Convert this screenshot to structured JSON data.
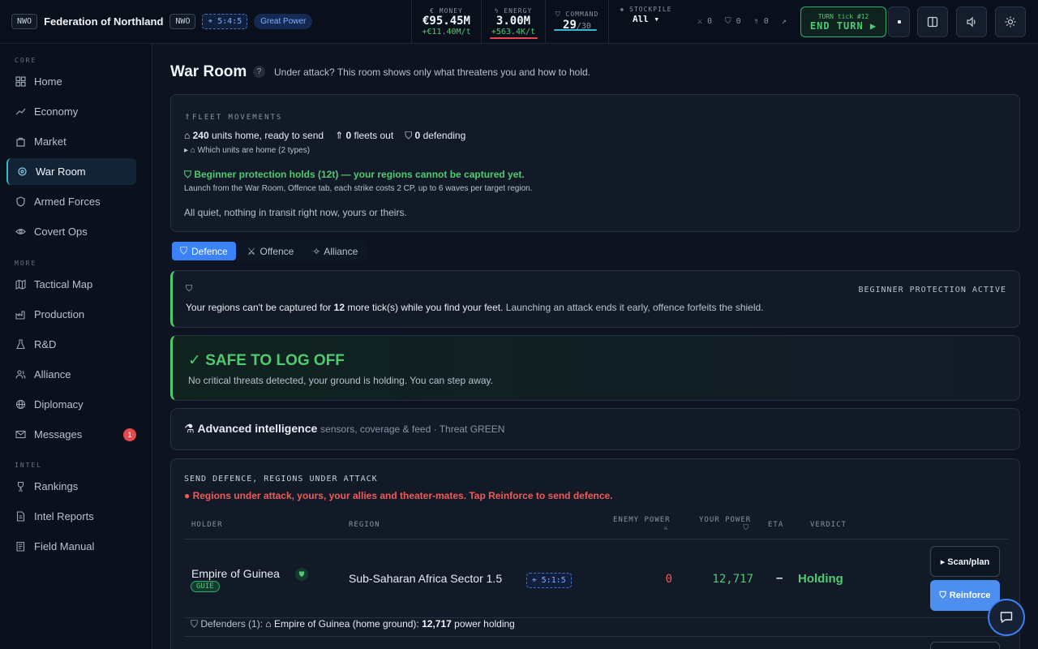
{
  "topbar": {
    "nation_code": "NWO",
    "nation_name": "Federation of Northland",
    "nation_code2": "NWO",
    "location": "5:4:5",
    "power_badge": "Great Power",
    "money_label": "€ MONEY",
    "money_value": "€95.45M",
    "money_rate": "+€11.40M/t",
    "energy_label": "ENERGY",
    "energy_value": "3.00M",
    "energy_rate": "+563.4K/t",
    "command_label": "COMMAND",
    "command_value": "29",
    "command_max": "/30",
    "stockpile_label": "STOCKPILE",
    "stockpile_value": "All ▾",
    "count_attack": "0",
    "count_defend": "0",
    "count_fleet": "0",
    "turn_label": "TURN tick #12",
    "end_turn_label": "END TURN ▶"
  },
  "sidebar": {
    "sections": [
      "CORE",
      "MORE",
      "INTEL"
    ],
    "core_items": [
      "Home",
      "Economy",
      "Market",
      "War Room",
      "Armed Forces",
      "Covert Ops"
    ],
    "more_items": [
      "Tactical Map",
      "Production",
      "R&D",
      "Alliance",
      "Diplomacy",
      "Messages"
    ],
    "intel_items": [
      "Rankings",
      "Intel Reports",
      "Field Manual"
    ],
    "messages_badge": "1"
  },
  "page": {
    "title": "War Room",
    "help": "?",
    "subtitle": "Under attack? This room shows only what threatens you and how to hold."
  },
  "fleet": {
    "label": "FLEET MOVEMENTS",
    "units_home_count": "240",
    "units_home_text": "units home, ready to send",
    "fleets_out_count": "0",
    "fleets_out_text": "fleets out",
    "defending_count": "0",
    "defending_text": "defending",
    "units_toggle": "Which units are home (2 types)",
    "protection_text": "Beginner protection holds (12t) — your regions cannot be captured yet.",
    "launch_text": "Launch from the War Room, Offence tab, each strike costs 2 CP, up to 6 waves per target region.",
    "quiet_text": "All quiet, nothing in transit right now, yours or theirs."
  },
  "tabs": [
    "Defence",
    "Offence",
    "Alliance"
  ],
  "protection": {
    "tag": "BEGINNER PROTECTION ACTIVE",
    "text_a": "Your regions can't be captured for",
    "ticks": "12",
    "text_b": "more tick(s) while you find your feet.",
    "text_c": "Launching an attack ends it early, offence forfeits the shield."
  },
  "safe": {
    "title": "SAFE TO LOG OFF",
    "text": "No critical threats detected, your ground is holding. You can step away."
  },
  "intel": {
    "title": "Advanced intelligence",
    "subtitle": "sensors, coverage & feed · Threat GREEN"
  },
  "defence": {
    "label": "SEND DEFENCE, REGIONS UNDER ATTACK",
    "alert": "Regions under attack, yours, your allies and theater-mates. Tap Reinforce to send defence.",
    "headers": {
      "holder": "HOLDER",
      "region": "REGION",
      "enemy": "ENEMY POWER",
      "yours": "YOUR POWER",
      "eta": "ETA",
      "verdict": "VERDICT"
    },
    "row": {
      "holder": "Empire of Guinea",
      "holder_code": "GUIE",
      "region": "Sub-Saharan Africa Sector 1.5",
      "region_loc": "5:1:5",
      "enemy_power": "0",
      "your_power": "12,717",
      "eta": "–",
      "verdict": "Holding",
      "scan_label": "▸ Scan/plan",
      "reinforce_label": "Reinforce",
      "defenders_label": "Defenders (1):",
      "defender_name": "Empire of Guinea (home ground):",
      "defender_power": "12,717",
      "defender_suffix": "power holding"
    }
  },
  "colors": {
    "accent_blue": "#3b82f6",
    "safe_green": "#4ecb71",
    "danger_red": "#ef5a5a"
  }
}
